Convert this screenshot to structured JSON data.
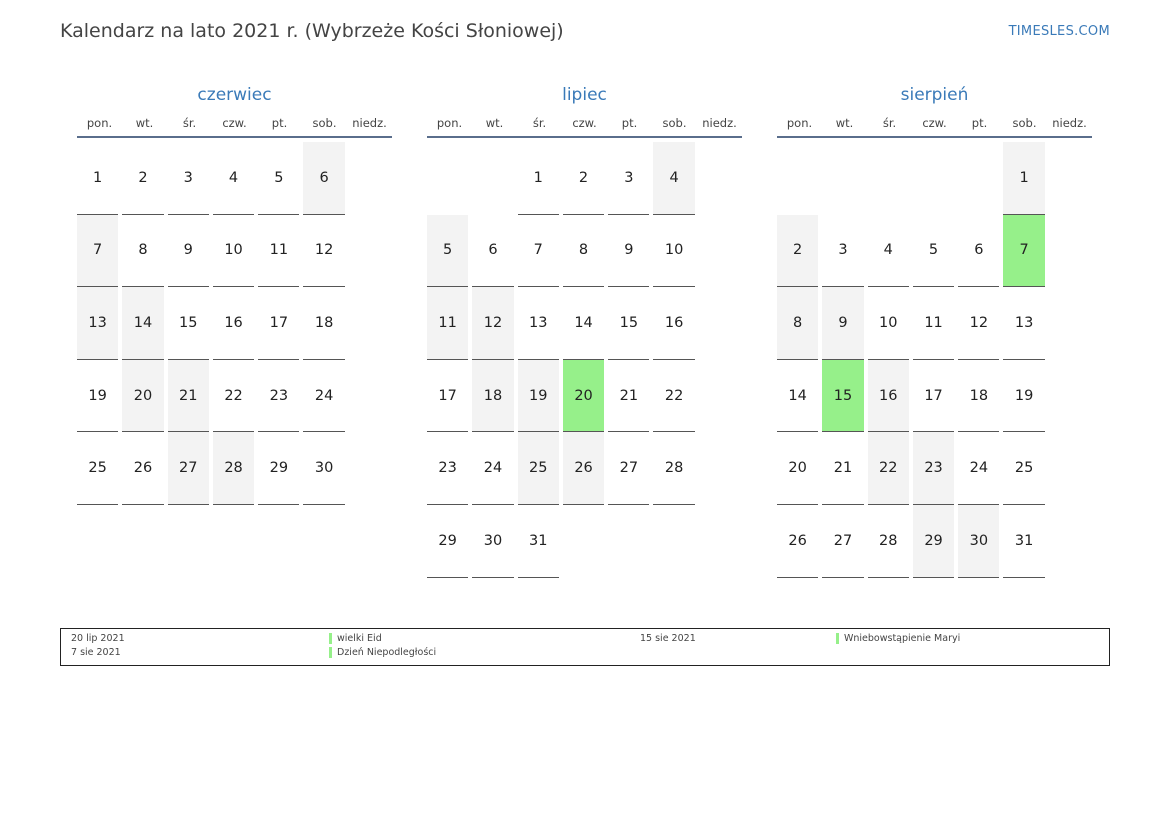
{
  "header": {
    "title": "Kalendarz na lato 2021 r. (Wybrzeże Kości Słoniowej)",
    "site": "TIMESLES.COM"
  },
  "weekday_labels": [
    "pon.",
    "wt.",
    "śr.",
    "czw.",
    "pt.",
    "sob.",
    "niedz."
  ],
  "colors": {
    "accent": "#3a7ab8",
    "holiday": "#96f08a",
    "weekend": "#f3f3f3"
  },
  "months": [
    {
      "name": "czerwiec",
      "first_weekday": 1,
      "days": 30,
      "holidays": []
    },
    {
      "name": "lipiec",
      "first_weekday": 3,
      "days": 31,
      "holidays": [
        20
      ]
    },
    {
      "name": "sierpień",
      "first_weekday": 6,
      "days": 31,
      "holidays": [
        7,
        15
      ]
    }
  ],
  "legend": [
    {
      "date": "20 lip 2021",
      "name": "wielki Eid"
    },
    {
      "date": "7 sie 2021",
      "name": "Dzień Niepodległości"
    },
    {
      "date": "15 sie 2021",
      "name": "Wniebowstąpienie Maryi"
    }
  ]
}
